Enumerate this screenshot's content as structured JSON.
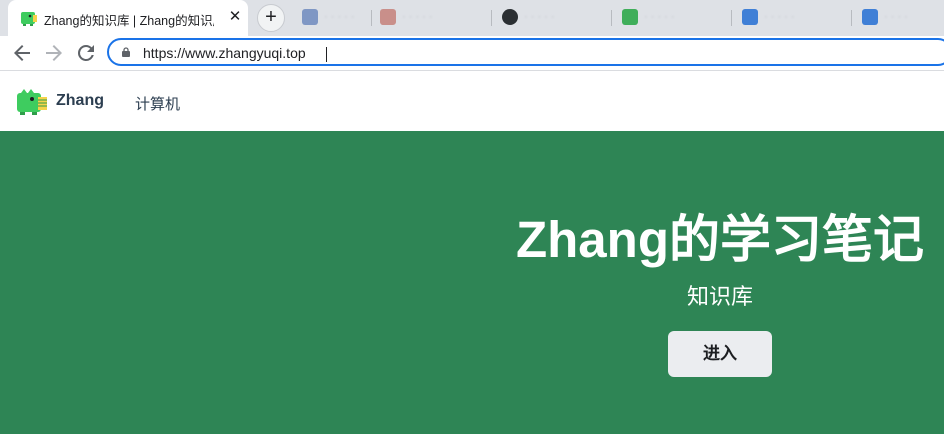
{
  "browser": {
    "active_tab": {
      "title": "Zhang的知识库 | Zhang的知识库",
      "close_icon": "close-icon",
      "favicon": "dinosaur-logo-icon"
    },
    "new_tab_icon": "plus-icon",
    "inactive_tabs": [
      {
        "favicon_color": "#7f97c4"
      },
      {
        "favicon_color": "#c98f8a"
      },
      {
        "favicon_color": "#2b2f33"
      },
      {
        "favicon_color": "#3fae5a"
      },
      {
        "favicon_color": "#3f7fd6"
      },
      {
        "favicon_color": "#3f7fd6"
      }
    ],
    "nav": {
      "back_icon": "arrow-left-icon",
      "forward_icon": "arrow-right-icon",
      "reload_icon": "reload-icon"
    },
    "url": "https://www.zhangyuqi.top",
    "lock_icon": "lock-icon",
    "accent_color": "#1a73e8"
  },
  "site": {
    "logo_icon": "dinosaur-logo-icon",
    "brand": "Zhang",
    "nav_items": [
      "计算机"
    ]
  },
  "hero": {
    "title": "Zhang的学习笔记",
    "subtitle": "知识库",
    "button_label": "进入",
    "background_color": "#2e8555"
  }
}
